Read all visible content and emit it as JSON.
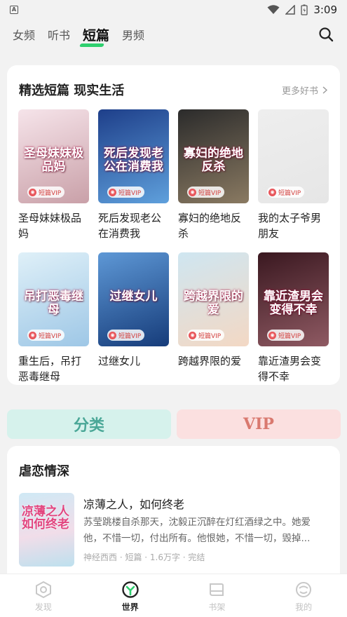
{
  "status_bar": {
    "time": "3:09",
    "app_indicator": "A"
  },
  "top_tabs": [
    {
      "label": "女频",
      "active": false
    },
    {
      "label": "听书",
      "active": false
    },
    {
      "label": "短篇",
      "active": true
    },
    {
      "label": "男频",
      "active": false
    }
  ],
  "featured_section": {
    "title": "精选短篇 现实生活",
    "more_label": "更多好书",
    "badge_label": "短篇VIP",
    "books": [
      {
        "name": "圣母妹妹极品妈",
        "cover_text": "圣母妹妹极品妈",
        "cover_colors": [
          "#f6e4ea",
          "#c9a0a8"
        ]
      },
      {
        "name": "死后发现老公在消费我",
        "cover_text": "死后发现老公在消费我",
        "cover_colors": [
          "#1e3f8a",
          "#5fa0dc"
        ]
      },
      {
        "name": "寡妇的绝地反杀",
        "cover_text": "寡妇的绝地反杀",
        "cover_colors": [
          "#2b2b2b",
          "#8a7a62"
        ]
      },
      {
        "name": "我的太子爷男朋友",
        "cover_text": "",
        "cover_colors": [
          "#eeeeee",
          "#e6e6e6"
        ]
      },
      {
        "name": "重生后，吊打恶毒继母",
        "cover_text": "吊打恶毒继母",
        "cover_colors": [
          "#dff0f8",
          "#9ec7e6"
        ]
      },
      {
        "name": "过继女儿",
        "cover_text": "过继女儿",
        "cover_colors": [
          "#5e98d6",
          "#163c7a"
        ]
      },
      {
        "name": "跨越界限的爱",
        "cover_text": "跨越界限的爱",
        "cover_colors": [
          "#cfe6f1",
          "#f3d8c4"
        ]
      },
      {
        "name": "靠近渣男会变得不幸",
        "cover_text": "靠近渣男会变得不幸",
        "cover_colors": [
          "#3a1820",
          "#8f5a63"
        ]
      }
    ]
  },
  "category_buttons": {
    "fenlei": "分类",
    "vip": "VIP"
  },
  "second_section": {
    "title": "虐恋情深",
    "feature": {
      "title": "凉薄之人，如何终老",
      "cover_text": "凉薄之人如何终老",
      "description": "苏莹跳楼自杀那天，沈毅正沉醉在灯红酒绿之中。她爱他，不惜一切，付出所有。他恨她，不惜一切，毁掉...",
      "meta": "神经西西 · 短篇 · 1.6万字 · 完结"
    }
  },
  "bottom_nav": [
    {
      "label": "发现",
      "icon": "discover-icon",
      "active": false
    },
    {
      "label": "世界",
      "icon": "world-icon",
      "active": true
    },
    {
      "label": "书架",
      "icon": "bookshelf-icon",
      "active": false
    },
    {
      "label": "我的",
      "icon": "profile-icon",
      "active": false
    }
  ],
  "colors": {
    "accent_green": "#2fd06f",
    "vip_red": "#d3403e"
  }
}
